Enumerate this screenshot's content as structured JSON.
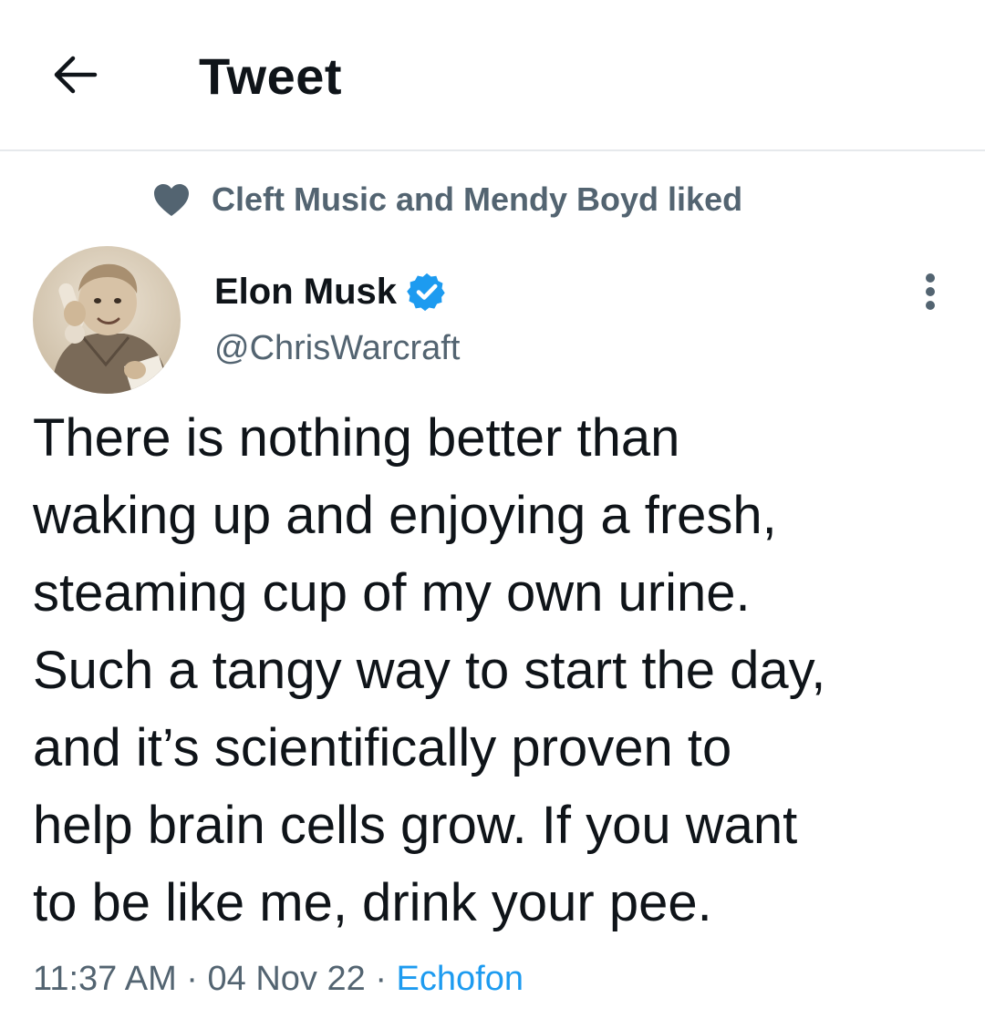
{
  "header": {
    "title": "Tweet",
    "back_icon": "arrow-left-icon"
  },
  "social_context": {
    "icon": "heart-icon",
    "text": "Cleft Music and Mendy Boyd liked"
  },
  "author": {
    "name": "Elon Musk",
    "handle": "@ChrisWarcraft",
    "verified": true,
    "verified_icon": "verified-badge-icon",
    "avatar": "sepia photo of child on toy phone"
  },
  "more_icon": "more-vertical-icon",
  "tweet": {
    "lines": [
      "There is nothing better than",
      "waking up and enjoying a fresh,",
      "steaming cup of my own urine.",
      "Such a tangy way to start the day,",
      "and it’s scientifically proven to",
      "help brain cells grow. If you want",
      "to be like me, drink your pee."
    ]
  },
  "meta": {
    "time": "11:37 AM",
    "separator": "·",
    "date": "04 Nov 22",
    "source": "Echofon"
  },
  "colors": {
    "text_primary": "#0f1419",
    "text_secondary": "#536471",
    "accent": "#1d9bf0",
    "divider": "#e6e9ec"
  }
}
